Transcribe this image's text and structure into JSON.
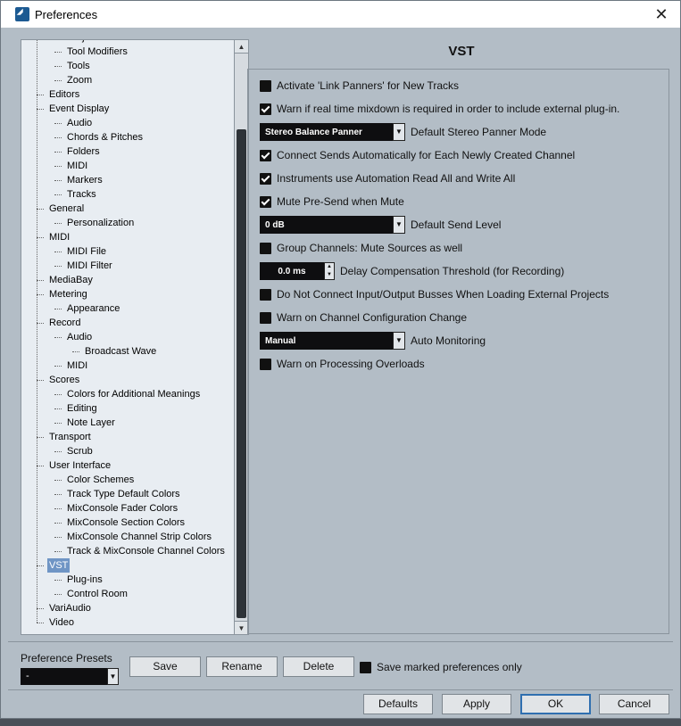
{
  "window": {
    "title": "Preferences",
    "close_glyph": "✕"
  },
  "tree": {
    "items": [
      {
        "label": "Project & Mixconsole",
        "level": 2
      },
      {
        "label": "Tool Modifiers",
        "level": 2
      },
      {
        "label": "Tools",
        "level": 2
      },
      {
        "label": "Zoom",
        "level": 2
      },
      {
        "label": "Editors",
        "level": 1
      },
      {
        "label": "Event Display",
        "level": 1
      },
      {
        "label": "Audio",
        "level": 2
      },
      {
        "label": "Chords & Pitches",
        "level": 2
      },
      {
        "label": "Folders",
        "level": 2
      },
      {
        "label": "MIDI",
        "level": 2
      },
      {
        "label": "Markers",
        "level": 2
      },
      {
        "label": "Tracks",
        "level": 2
      },
      {
        "label": "General",
        "level": 1
      },
      {
        "label": "Personalization",
        "level": 2
      },
      {
        "label": "MIDI",
        "level": 1
      },
      {
        "label": "MIDI File",
        "level": 2
      },
      {
        "label": "MIDI Filter",
        "level": 2
      },
      {
        "label": "MediaBay",
        "level": 1
      },
      {
        "label": "Metering",
        "level": 1
      },
      {
        "label": "Appearance",
        "level": 2
      },
      {
        "label": "Record",
        "level": 1
      },
      {
        "label": "Audio",
        "level": 2
      },
      {
        "label": "Broadcast Wave",
        "level": 3
      },
      {
        "label": "MIDI",
        "level": 2
      },
      {
        "label": "Scores",
        "level": 1
      },
      {
        "label": "Colors for Additional Meanings",
        "level": 2
      },
      {
        "label": "Editing",
        "level": 2
      },
      {
        "label": "Note Layer",
        "level": 2
      },
      {
        "label": "Transport",
        "level": 1
      },
      {
        "label": "Scrub",
        "level": 2
      },
      {
        "label": "User Interface",
        "level": 1
      },
      {
        "label": "Color Schemes",
        "level": 2
      },
      {
        "label": "Track Type Default Colors",
        "level": 2
      },
      {
        "label": "MixConsole Fader Colors",
        "level": 2
      },
      {
        "label": "MixConsole Section Colors",
        "level": 2
      },
      {
        "label": "MixConsole Channel Strip Colors",
        "level": 2
      },
      {
        "label": "Track & MixConsole Channel Colors",
        "level": 2
      },
      {
        "label": "VST",
        "level": 1,
        "selected": true
      },
      {
        "label": "Plug-ins",
        "level": 2
      },
      {
        "label": "Control Room",
        "level": 2
      },
      {
        "label": "VariAudio",
        "level": 1
      },
      {
        "label": "Video",
        "level": 1
      }
    ]
  },
  "page": {
    "title": "VST",
    "settings": [
      {
        "type": "checkbox",
        "checked": false,
        "label": "Activate 'Link Panners' for New Tracks"
      },
      {
        "type": "checkbox",
        "checked": true,
        "label": "Warn if real time mixdown is required in order to include external plug-in."
      },
      {
        "type": "dropdown",
        "value": "Stereo Balance Panner",
        "label": "Default Stereo Panner Mode"
      },
      {
        "type": "checkbox",
        "checked": true,
        "label": "Connect Sends Automatically for Each Newly Created Channel"
      },
      {
        "type": "checkbox",
        "checked": true,
        "label": "Instruments use Automation Read All and Write All"
      },
      {
        "type": "checkbox",
        "checked": true,
        "label": "Mute Pre-Send when Mute"
      },
      {
        "type": "dropdown",
        "value": "0 dB",
        "label": "Default Send Level"
      },
      {
        "type": "checkbox",
        "checked": false,
        "label": "Group Channels: Mute Sources as well"
      },
      {
        "type": "number",
        "value": "0.0 ms",
        "label": "Delay Compensation Threshold (for Recording)"
      },
      {
        "type": "checkbox",
        "checked": false,
        "label": "Do Not Connect Input/Output Busses When Loading External Projects"
      },
      {
        "type": "checkbox",
        "checked": false,
        "label": "Warn on Channel Configuration Change"
      },
      {
        "type": "dropdown",
        "value": "Manual",
        "label": "Auto Monitoring"
      },
      {
        "type": "checkbox",
        "checked": false,
        "label": "Warn on Processing Overloads"
      }
    ]
  },
  "presets": {
    "label": "Preference Presets",
    "selected": "-",
    "save": "Save",
    "rename": "Rename",
    "delete": "Delete",
    "save_marked_label": "Save marked preferences only",
    "save_marked_checked": false
  },
  "footer": {
    "defaults": "Defaults",
    "apply": "Apply",
    "ok": "OK",
    "cancel": "Cancel"
  },
  "colors": {
    "dialog_bg": "#b3bdc6",
    "tree_bg": "#e8edf2",
    "selected": "#6f95c5",
    "default_button_border": "#2f6fb0"
  }
}
